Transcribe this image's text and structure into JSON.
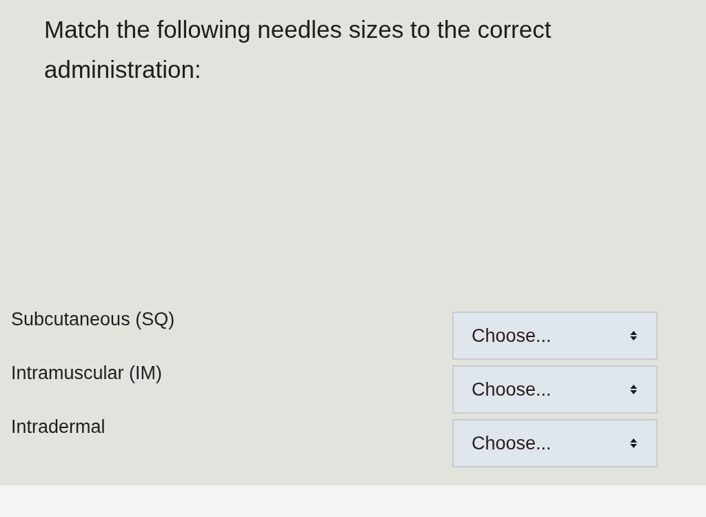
{
  "question": {
    "text": "Match the following needles sizes to the correct administration:"
  },
  "matches": [
    {
      "label": "Subcutaneous (SQ)",
      "dropdown": {
        "value": "Choose..."
      }
    },
    {
      "label": "Intramuscular (IM)",
      "dropdown": {
        "value": "Choose..."
      }
    },
    {
      "label": "Intradermal",
      "dropdown": {
        "value": "Choose..."
      }
    }
  ]
}
